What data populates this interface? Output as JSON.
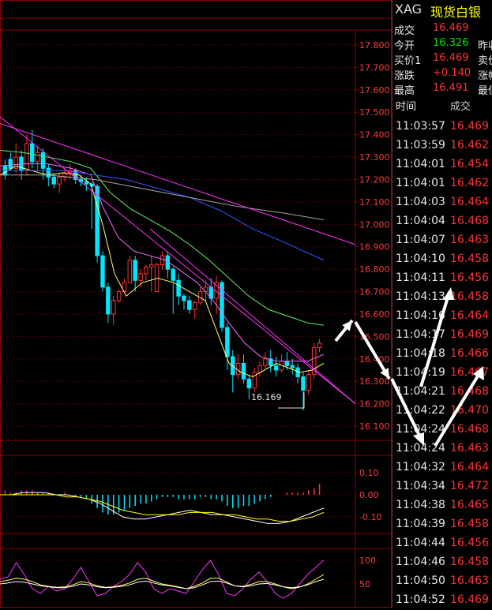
{
  "price_axis": {
    "ticks": [
      "17.800",
      "17.700",
      "17.600",
      "17.500",
      "17.400",
      "17.300",
      "17.200",
      "17.100",
      "17.000",
      "16.900",
      "16.800",
      "16.700",
      "16.600",
      "16.500",
      "16.400",
      "16.300",
      "16.200",
      "16.100"
    ],
    "low_label": "16.169"
  },
  "macd_axis": {
    "ticks": [
      "0.10",
      "0.00",
      "-0.10"
    ]
  },
  "kdj_axis": {
    "ticks": [
      "100",
      "50"
    ]
  },
  "header": {
    "symbol": "XAG",
    "name": "现货白银"
  },
  "quote": [
    {
      "label": "成交",
      "value": "16.469",
      "color": "#ff3232",
      "label2": ""
    },
    {
      "label": "今开",
      "value": "16.326",
      "color": "#00e600",
      "label2": "昨收"
    },
    {
      "label": "买价1",
      "value": "16.469",
      "color": "#ff3232",
      "label2": "卖价"
    },
    {
      "label": "涨跌",
      "value": "+0.140",
      "color": "#ff3232",
      "label2": "涨幅"
    },
    {
      "label": "最高",
      "value": "16.491",
      "color": "#ff3232",
      "label2": "最低"
    }
  ],
  "ticks_table": {
    "header": {
      "time": "时间",
      "price": "成交"
    },
    "rows": [
      {
        "time": "11:03:57",
        "price": "16.469"
      },
      {
        "time": "11:03:59",
        "price": "16.462"
      },
      {
        "time": "11:04:01",
        "price": "16.454"
      },
      {
        "time": "11:04:01",
        "price": "16.462"
      },
      {
        "time": "11:04:03",
        "price": "16.464"
      },
      {
        "time": "11:04:04",
        "price": "16.468"
      },
      {
        "time": "11:04:07",
        "price": "16.463"
      },
      {
        "time": "11:04:10",
        "price": "16.458"
      },
      {
        "time": "11:04:11",
        "price": "16.456"
      },
      {
        "time": "11:04:13",
        "price": "16.458"
      },
      {
        "time": "11:04:16",
        "price": "16.464"
      },
      {
        "time": "11:04:17",
        "price": "16.469"
      },
      {
        "time": "11:04:18",
        "price": "16.466"
      },
      {
        "time": "11:04:19",
        "price": "16.467"
      },
      {
        "time": "11:04:21",
        "price": "16.468"
      },
      {
        "time": "11:04:22",
        "price": "16.470"
      },
      {
        "time": "11:04:24",
        "price": "16.468"
      },
      {
        "time": "11:04:24",
        "price": "16.463"
      },
      {
        "time": "11:04:32",
        "price": "16.464"
      },
      {
        "time": "11:04:34",
        "price": "16.472"
      },
      {
        "time": "11:04:38",
        "price": "16.465"
      },
      {
        "time": "11:04:39",
        "price": "16.458"
      },
      {
        "time": "11:04:44",
        "price": "16.456"
      },
      {
        "time": "11:04:46",
        "price": "16.458"
      },
      {
        "time": "11:04:50",
        "price": "16.463"
      },
      {
        "time": "11:04:52",
        "price": "16.469"
      }
    ]
  },
  "colors": {
    "up": "#ff3232",
    "down": "#00e6ff",
    "grid": "#8b0000",
    "axis_text": "#ff3c3c",
    "time_text": "#e8e8e8"
  },
  "candles": [
    [
      17.26,
      17.29,
      17.22,
      17.2
    ],
    [
      17.29,
      17.32,
      17.25,
      17.24
    ],
    [
      17.25,
      17.36,
      17.3,
      17.23
    ],
    [
      17.3,
      17.33,
      17.24,
      17.2
    ],
    [
      17.24,
      17.4,
      17.36,
      17.22
    ],
    [
      17.36,
      17.42,
      17.28,
      17.25
    ],
    [
      17.28,
      17.35,
      17.32,
      17.24
    ],
    [
      17.32,
      17.34,
      17.25,
      17.2
    ],
    [
      17.25,
      17.27,
      17.21,
      17.17
    ],
    [
      17.21,
      17.23,
      17.18,
      17.16
    ],
    [
      17.18,
      17.23,
      17.21,
      17.14
    ],
    [
      17.21,
      17.25,
      17.23,
      17.19
    ],
    [
      17.23,
      17.27,
      17.24,
      17.2
    ],
    [
      17.24,
      17.25,
      17.2,
      17.18
    ],
    [
      17.2,
      17.22,
      17.19,
      17.17
    ],
    [
      17.19,
      17.21,
      17.18,
      17.15
    ],
    [
      17.18,
      17.19,
      17.17,
      16.98
    ],
    [
      17.17,
      17.18,
      16.86,
      16.83
    ],
    [
      16.86,
      16.88,
      16.72,
      16.7
    ],
    [
      16.72,
      16.74,
      16.6,
      16.56
    ],
    [
      16.6,
      16.68,
      16.66,
      16.55
    ],
    [
      16.66,
      16.71,
      16.7,
      16.65
    ],
    [
      16.7,
      16.76,
      16.74,
      16.7
    ],
    [
      16.74,
      16.86,
      16.84,
      16.74
    ],
    [
      16.84,
      16.86,
      16.75,
      16.7
    ],
    [
      16.75,
      16.8,
      16.78,
      16.72
    ],
    [
      16.78,
      16.82,
      16.81,
      16.75
    ],
    [
      16.81,
      16.86,
      16.82,
      16.7
    ],
    [
      16.7,
      16.83,
      16.82,
      16.8
    ],
    [
      16.82,
      16.88,
      16.86,
      16.8
    ],
    [
      16.86,
      16.88,
      16.8,
      16.76
    ],
    [
      16.8,
      16.81,
      16.75,
      16.6
    ],
    [
      16.75,
      16.78,
      16.68,
      16.64
    ],
    [
      16.68,
      16.69,
      16.66,
      16.62
    ],
    [
      16.66,
      16.68,
      16.62,
      16.6
    ],
    [
      16.62,
      16.66,
      16.65,
      16.58
    ],
    [
      16.65,
      16.72,
      16.7,
      16.64
    ],
    [
      16.7,
      16.75,
      16.72,
      16.66
    ],
    [
      16.72,
      16.76,
      16.67,
      16.64
    ],
    [
      16.67,
      16.77,
      16.74,
      16.6
    ],
    [
      16.74,
      16.75,
      16.54,
      16.52
    ],
    [
      16.54,
      16.56,
      16.41,
      16.35
    ],
    [
      16.41,
      16.44,
      16.33,
      16.25
    ],
    [
      16.33,
      16.42,
      16.38,
      16.31
    ],
    [
      16.38,
      16.42,
      16.31,
      16.29
    ],
    [
      16.31,
      16.33,
      16.27,
      16.22
    ],
    [
      16.27,
      16.36,
      16.34,
      16.25
    ],
    [
      16.34,
      16.39,
      16.37,
      16.32
    ],
    [
      16.37,
      16.43,
      16.4,
      16.35
    ],
    [
      16.4,
      16.44,
      16.37,
      16.34
    ],
    [
      16.37,
      16.41,
      16.35,
      16.32
    ],
    [
      16.35,
      16.42,
      16.39,
      16.34
    ],
    [
      16.39,
      16.43,
      16.37,
      16.35
    ],
    [
      16.37,
      16.4,
      16.36,
      16.33
    ],
    [
      16.36,
      16.38,
      16.32,
      16.29
    ],
    [
      16.32,
      16.34,
      16.26,
      16.17
    ],
    [
      16.26,
      16.35,
      16.33,
      16.24
    ],
    [
      16.33,
      16.47,
      16.45,
      16.31
    ],
    [
      16.45,
      16.49,
      16.47,
      16.43
    ]
  ],
  "ma_lines": [
    {
      "color": "#ffff66",
      "pts": [
        [
          0,
          17.22
        ],
        [
          20,
          17.26
        ],
        [
          40,
          17.24
        ],
        [
          60,
          17.22
        ],
        [
          80,
          17.23
        ],
        [
          100,
          17.22
        ],
        [
          115,
          17.18
        ],
        [
          130,
          17.0
        ],
        [
          145,
          16.78
        ],
        [
          160,
          16.68
        ],
        [
          180,
          16.74
        ],
        [
          200,
          16.76
        ],
        [
          220,
          16.74
        ],
        [
          240,
          16.7
        ],
        [
          260,
          16.66
        ],
        [
          275,
          16.52
        ],
        [
          290,
          16.38
        ],
        [
          305,
          16.34
        ],
        [
          320,
          16.32
        ],
        [
          335,
          16.35
        ],
        [
          350,
          16.38
        ],
        [
          365,
          16.36
        ],
        [
          380,
          16.34
        ],
        [
          395,
          16.35
        ],
        [
          410,
          16.38
        ]
      ]
    },
    {
      "color": "#ff66ff",
      "pts": [
        [
          0,
          17.26
        ],
        [
          30,
          17.27
        ],
        [
          60,
          17.27
        ],
        [
          90,
          17.25
        ],
        [
          115,
          17.22
        ],
        [
          130,
          17.08
        ],
        [
          150,
          16.94
        ],
        [
          170,
          16.88
        ],
        [
          190,
          16.86
        ],
        [
          210,
          16.84
        ],
        [
          230,
          16.79
        ],
        [
          250,
          16.74
        ],
        [
          270,
          16.66
        ],
        [
          290,
          16.56
        ],
        [
          310,
          16.47
        ],
        [
          330,
          16.41
        ],
        [
          350,
          16.39
        ],
        [
          370,
          16.39
        ],
        [
          390,
          16.39
        ],
        [
          410,
          16.42
        ]
      ]
    },
    {
      "color": "#66ee66",
      "pts": [
        [
          0,
          17.33
        ],
        [
          30,
          17.32
        ],
        [
          60,
          17.3
        ],
        [
          90,
          17.28
        ],
        [
          115,
          17.25
        ],
        [
          140,
          17.14
        ],
        [
          165,
          17.07
        ],
        [
          190,
          17.02
        ],
        [
          215,
          16.97
        ],
        [
          240,
          16.91
        ],
        [
          265,
          16.84
        ],
        [
          290,
          16.76
        ],
        [
          315,
          16.68
        ],
        [
          340,
          16.62
        ],
        [
          365,
          16.59
        ],
        [
          390,
          16.56
        ],
        [
          410,
          16.55
        ]
      ]
    },
    {
      "color": "#3355ff",
      "pts": [
        [
          0,
          17.24
        ],
        [
          40,
          17.24
        ],
        [
          80,
          17.24
        ],
        [
          120,
          17.22
        ],
        [
          160,
          17.2
        ],
        [
          200,
          17.16
        ],
        [
          240,
          17.12
        ],
        [
          280,
          17.06
        ],
        [
          320,
          16.98
        ],
        [
          360,
          16.92
        ],
        [
          410,
          16.84
        ]
      ]
    },
    {
      "color": "#a8a8a8",
      "pts": [
        [
          0,
          17.22
        ],
        [
          60,
          17.22
        ],
        [
          120,
          17.2
        ],
        [
          180,
          17.16
        ],
        [
          240,
          17.12
        ],
        [
          300,
          17.08
        ],
        [
          360,
          17.05
        ],
        [
          410,
          17.02
        ]
      ]
    }
  ],
  "trend_lines": [
    {
      "color": "#ff33ff",
      "from": [
        0,
        17.48
      ],
      "to": [
        450,
        16.2
      ]
    },
    {
      "color": "#ff33ff",
      "from": [
        0,
        17.45
      ],
      "to": [
        450,
        16.91
      ]
    },
    {
      "color": "#ff33ff",
      "from": [
        190,
        16.98
      ],
      "to": [
        450,
        16.2
      ]
    }
  ],
  "macd": {
    "bars": [
      0.02,
      0.01,
      0.01,
      0.02,
      0.02,
      0.02,
      0.01,
      0.01,
      0.01,
      0.0,
      0.0,
      0.01,
      0.0,
      -0.01,
      -0.01,
      -0.02,
      -0.04,
      -0.06,
      -0.08,
      -0.09,
      -0.09,
      -0.08,
      -0.07,
      -0.06,
      -0.05,
      -0.04,
      -0.04,
      -0.03,
      -0.02,
      -0.01,
      -0.01,
      -0.01,
      -0.02,
      -0.02,
      -0.02,
      -0.02,
      -0.01,
      -0.01,
      -0.02,
      -0.02,
      -0.03,
      -0.05,
      -0.06,
      -0.06,
      -0.05,
      -0.05,
      -0.04,
      -0.03,
      -0.02,
      -0.01,
      0.0,
      0.0,
      0.01,
      0.01,
      0.01,
      0.01,
      0.02,
      0.03,
      0.05
    ],
    "dif": [
      0.0,
      0.0,
      0.01,
      0.01,
      0.01,
      0.0,
      0.0,
      -0.01,
      -0.02,
      -0.04,
      -0.07,
      -0.1,
      -0.11,
      -0.11,
      -0.1,
      -0.09,
      -0.08,
      -0.07,
      -0.08,
      -0.09,
      -0.09,
      -0.1,
      -0.11,
      -0.12,
      -0.13,
      -0.13,
      -0.12,
      -0.1,
      -0.08,
      -0.06
    ],
    "dea": [
      0.0,
      0.0,
      0.0,
      0.0,
      0.0,
      0.0,
      -0.01,
      -0.01,
      -0.02,
      -0.03,
      -0.05,
      -0.07,
      -0.08,
      -0.09,
      -0.09,
      -0.09,
      -0.09,
      -0.08,
      -0.08,
      -0.08,
      -0.09,
      -0.09,
      -0.1,
      -0.11,
      -0.11,
      -0.12,
      -0.12,
      -0.11,
      -0.1,
      -0.08
    ]
  },
  "kdj": {
    "k": [
      60,
      65,
      95,
      70,
      40,
      30,
      45,
      35,
      40,
      60,
      85,
      55,
      25,
      30,
      45,
      55,
      70,
      95,
      75,
      40,
      30,
      40,
      35,
      30,
      55,
      80,
      100,
      70,
      30,
      25,
      40,
      60,
      75,
      55,
      30,
      20,
      30,
      50,
      70,
      85,
      100
    ],
    "d": [
      55,
      58,
      62,
      60,
      55,
      48,
      45,
      43,
      44,
      48,
      55,
      52,
      46,
      43,
      44,
      47,
      52,
      60,
      62,
      56,
      50,
      47,
      44,
      40,
      45,
      52,
      62,
      62,
      54,
      46,
      45,
      49,
      55,
      55,
      50,
      44,
      40,
      43,
      50,
      60,
      70
    ],
    "j": [
      50,
      52,
      55,
      54,
      50,
      46,
      44,
      42,
      42,
      45,
      50,
      48,
      44,
      42,
      43,
      45,
      48,
      54,
      56,
      52,
      48,
      46,
      43,
      40,
      42,
      48,
      55,
      56,
      52,
      46,
      44,
      46,
      50,
      51,
      48,
      44,
      42,
      44,
      48,
      55,
      60
    ]
  }
}
